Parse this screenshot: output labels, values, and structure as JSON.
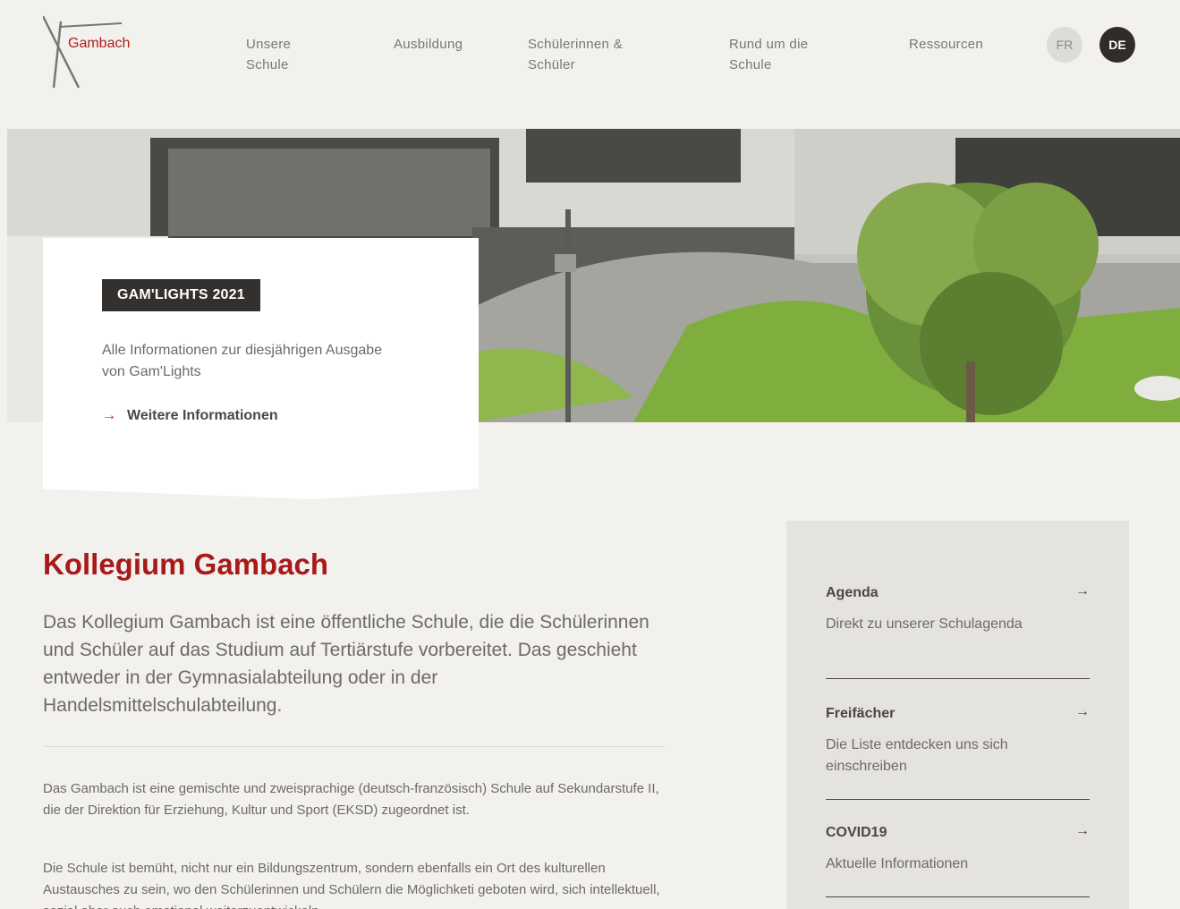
{
  "header": {
    "logo_text": "Gambach",
    "nav": [
      {
        "line1": "Unsere",
        "line2": "Schule"
      },
      {
        "line1": "Ausbildung",
        "line2": ""
      },
      {
        "line1": "Schülerinnen &",
        "line2": "Schüler"
      },
      {
        "line1": "Rund um die",
        "line2": "Schule"
      },
      {
        "line1": "Ressourcen",
        "line2": ""
      }
    ],
    "languages": {
      "fr": "FR",
      "de": "DE"
    },
    "accent_color": "#b01c1c"
  },
  "promo": {
    "badge": "GAM'LIGHTS 2021",
    "text": "Alle Informationen zur diesjährigen Ausgabe von Gam'Lights",
    "link": "Weitere Informationen",
    "arrow_icon": "→"
  },
  "main": {
    "title": "Kollegium Gambach",
    "lead": "Das Kollegium Gambach ist eine öffentliche Schule, die die Schülerinnen und Schüler auf das Studium auf Tertiärstufe vorbereitet. Das geschieht entweder in der Gymnasialabteilung oder in der Handelsmittelschulabteilung.",
    "para1": "Das Gambach ist eine gemischte und zweisprachige (deutsch-französisch) Schule auf Sekundarstufe II, die der Direktion für Erziehung, Kultur und Sport (EKSD) zugeordnet ist.",
    "para2": "Die Schule ist bemüht, nicht nur ein Bildungszentrum, sondern ebenfalls ein Ort des kulturellen Austausches zu sein, wo den Schülerinnen und Schülern die Möglichketi geboten wird, sich intellektuell, sozial aber auch emotional weiterzuentwickeln."
  },
  "sidebar": {
    "arrow_icon": "→",
    "items": [
      {
        "title": "Agenda",
        "desc": "Direkt zu unserer Schulagenda"
      },
      {
        "title": "Freifächer",
        "desc": "Die Liste entdecken uns sich einschreiben"
      },
      {
        "title": "COVID19",
        "desc": "Aktuelle Informationen"
      }
    ]
  }
}
